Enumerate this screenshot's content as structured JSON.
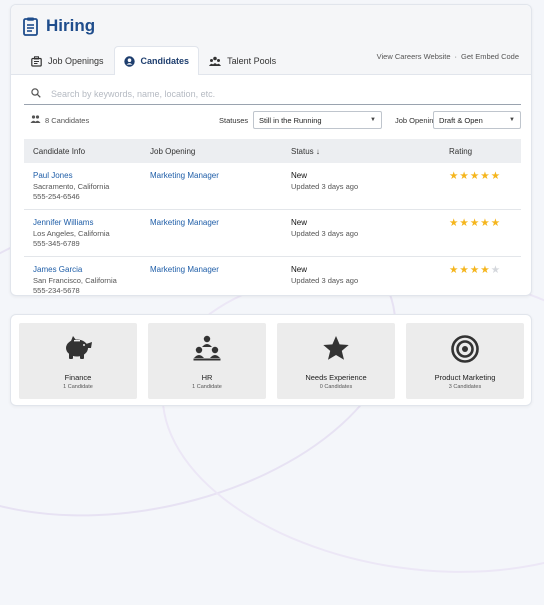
{
  "app": {
    "title": "Hiring"
  },
  "tabs": [
    {
      "label": "Job Openings",
      "icon": "briefcase-icon",
      "active": false
    },
    {
      "label": "Candidates",
      "icon": "user-circle-icon",
      "active": true
    },
    {
      "label": "Talent Pools",
      "icon": "people-group-icon",
      "active": false
    }
  ],
  "header_links": {
    "careers": "View Careers Website",
    "separator": "·",
    "embed": "Get Embed Code"
  },
  "search": {
    "placeholder": "Search by keywords, name, location, etc.",
    "value": ""
  },
  "filters": {
    "count": "8 Candidates",
    "statuses_label": "Statuses",
    "statuses_value": "Still in the Running",
    "openings_label": "Job Openings",
    "openings_value": "Draft & Open"
  },
  "table": {
    "headers": [
      "Candidate Info",
      "Job Opening",
      "Status ↓",
      "Rating"
    ],
    "rows": [
      {
        "name": "Paul Jones",
        "location": "Sacramento, California",
        "phone": "555-254-6546",
        "job": "Marketing Manager",
        "status": "New",
        "updated": "Updated 3 days ago",
        "rating": 5
      },
      {
        "name": "Jennifer Williams",
        "location": "Los Angeles, California",
        "phone": "555-345-6789",
        "job": "Marketing Manager",
        "status": "New",
        "updated": "Updated 3 days ago",
        "rating": 5
      },
      {
        "name": "James Garcia",
        "location": "San Francisco, California",
        "phone": "555-234-5678",
        "job": "Marketing Manager",
        "status": "New",
        "updated": "Updated 3 days ago",
        "rating": 4
      }
    ]
  },
  "talent_pools": [
    {
      "name": "Finance",
      "count": "1 Candidate",
      "icon": "piggy-bank-icon"
    },
    {
      "name": "HR",
      "count": "1 Candidate",
      "icon": "people-hierarchy-icon"
    },
    {
      "name": "Needs Experience",
      "count": "0 Candidates",
      "icon": "star-icon"
    },
    {
      "name": "Product Marketing",
      "count": "3 Candidates",
      "icon": "target-icon"
    }
  ],
  "colors": {
    "brand": "#1f4d8c",
    "link": "#1f5ea8",
    "star": "#f5b51c",
    "star_empty": "#d4d7dc",
    "table_header_bg": "#eceef1",
    "pool_bg": "#ececec"
  }
}
